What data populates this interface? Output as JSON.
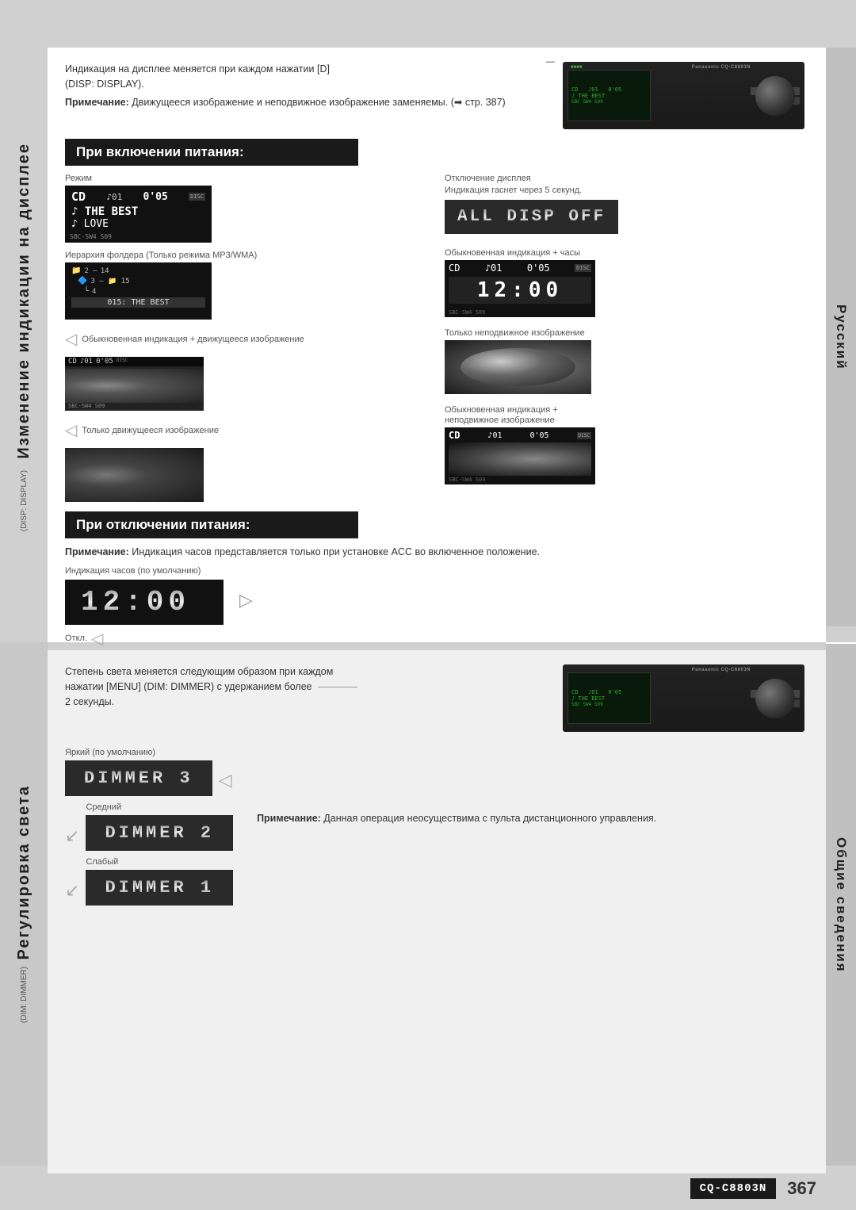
{
  "page": {
    "number": "367",
    "model": "CQ-C8803N"
  },
  "top_label": {
    "main_text": "Изменение индикации на дисплее",
    "sub_text": "(DISP: DISPLAY)"
  },
  "right_labels": {
    "top": "Русский",
    "bottom": "Общие сведения"
  },
  "top_note": {
    "line1": "Индикация на дисплее меняется при каждом нажатии [D]",
    "line2": "(DISP: DISPLAY).",
    "note_bold": "Примечание:",
    "note_text": " Движущееся изображение и неподвижное изображение заменяемы. (➡ стр. 387)"
  },
  "section_power_on": {
    "title": "При включении питания:",
    "mode_label": "Режим",
    "cd_display": {
      "top": "CD",
      "track": "♪01",
      "time": "0'05",
      "line1": "♪ THE BEST",
      "line2": "♪ LOVE",
      "footer": "SBC-SW4 S09",
      "badge": "DISC"
    },
    "all_disp_off_label_line1": "Отключение дисплея",
    "all_disp_off_label_line2": "Индикация гаснет через 5 секунд.",
    "all_disp_off_text": "ALL DISP OFF",
    "folder_label": "Иерархия фолдера (Только режима MP3/WMA)",
    "folder_display": "015: THE BEST",
    "clock_label": "Обыкновенная индикация + часы",
    "clock_cd": "CD",
    "clock_track": "♪01",
    "clock_time_top": "0'05",
    "clock_time": "12:00",
    "clock_badge": "DISC",
    "motion_label": "Обыкновенная индикация + движущееся изображение",
    "still_label": "Только неподвижное изображение",
    "motion_only_label": "Только движущееся изображение",
    "combined_label_line1": "Обыкновенная индикация +",
    "combined_label_line2": "неподвижное изображение"
  },
  "section_power_off": {
    "title": "При отключении питания:",
    "note_bold": "Примечание:",
    "note_text": " Индикация часов представляется только при установке ACC во включенное положение.",
    "clock_label": "Индикация часов (по умолчанию)",
    "clock_time": "12:00",
    "off_label": "Откл."
  },
  "bottom_section": {
    "intro_line1": "Степень света меняется следующим образом при каждом",
    "intro_line2": "нажатии [MENU] (DIM: DIMMER) с удержанием более",
    "intro_line3": "2 секунды.",
    "label_left": "Регулировка света",
    "label_sub": "(DIM: DIMMER)",
    "dimmer3_label": "Яркий (по умолчанию)",
    "dimmer3_text": "DIMMER 3",
    "dimmer2_label": "Средний",
    "dimmer2_text": "DIMMER 2",
    "dimmer1_label": "Слабый",
    "dimmer1_text": "DIMMER 1",
    "note_bold": "Примечание:",
    "note_text": " Данная операция неосуществима с пульта дистанционного управления."
  }
}
